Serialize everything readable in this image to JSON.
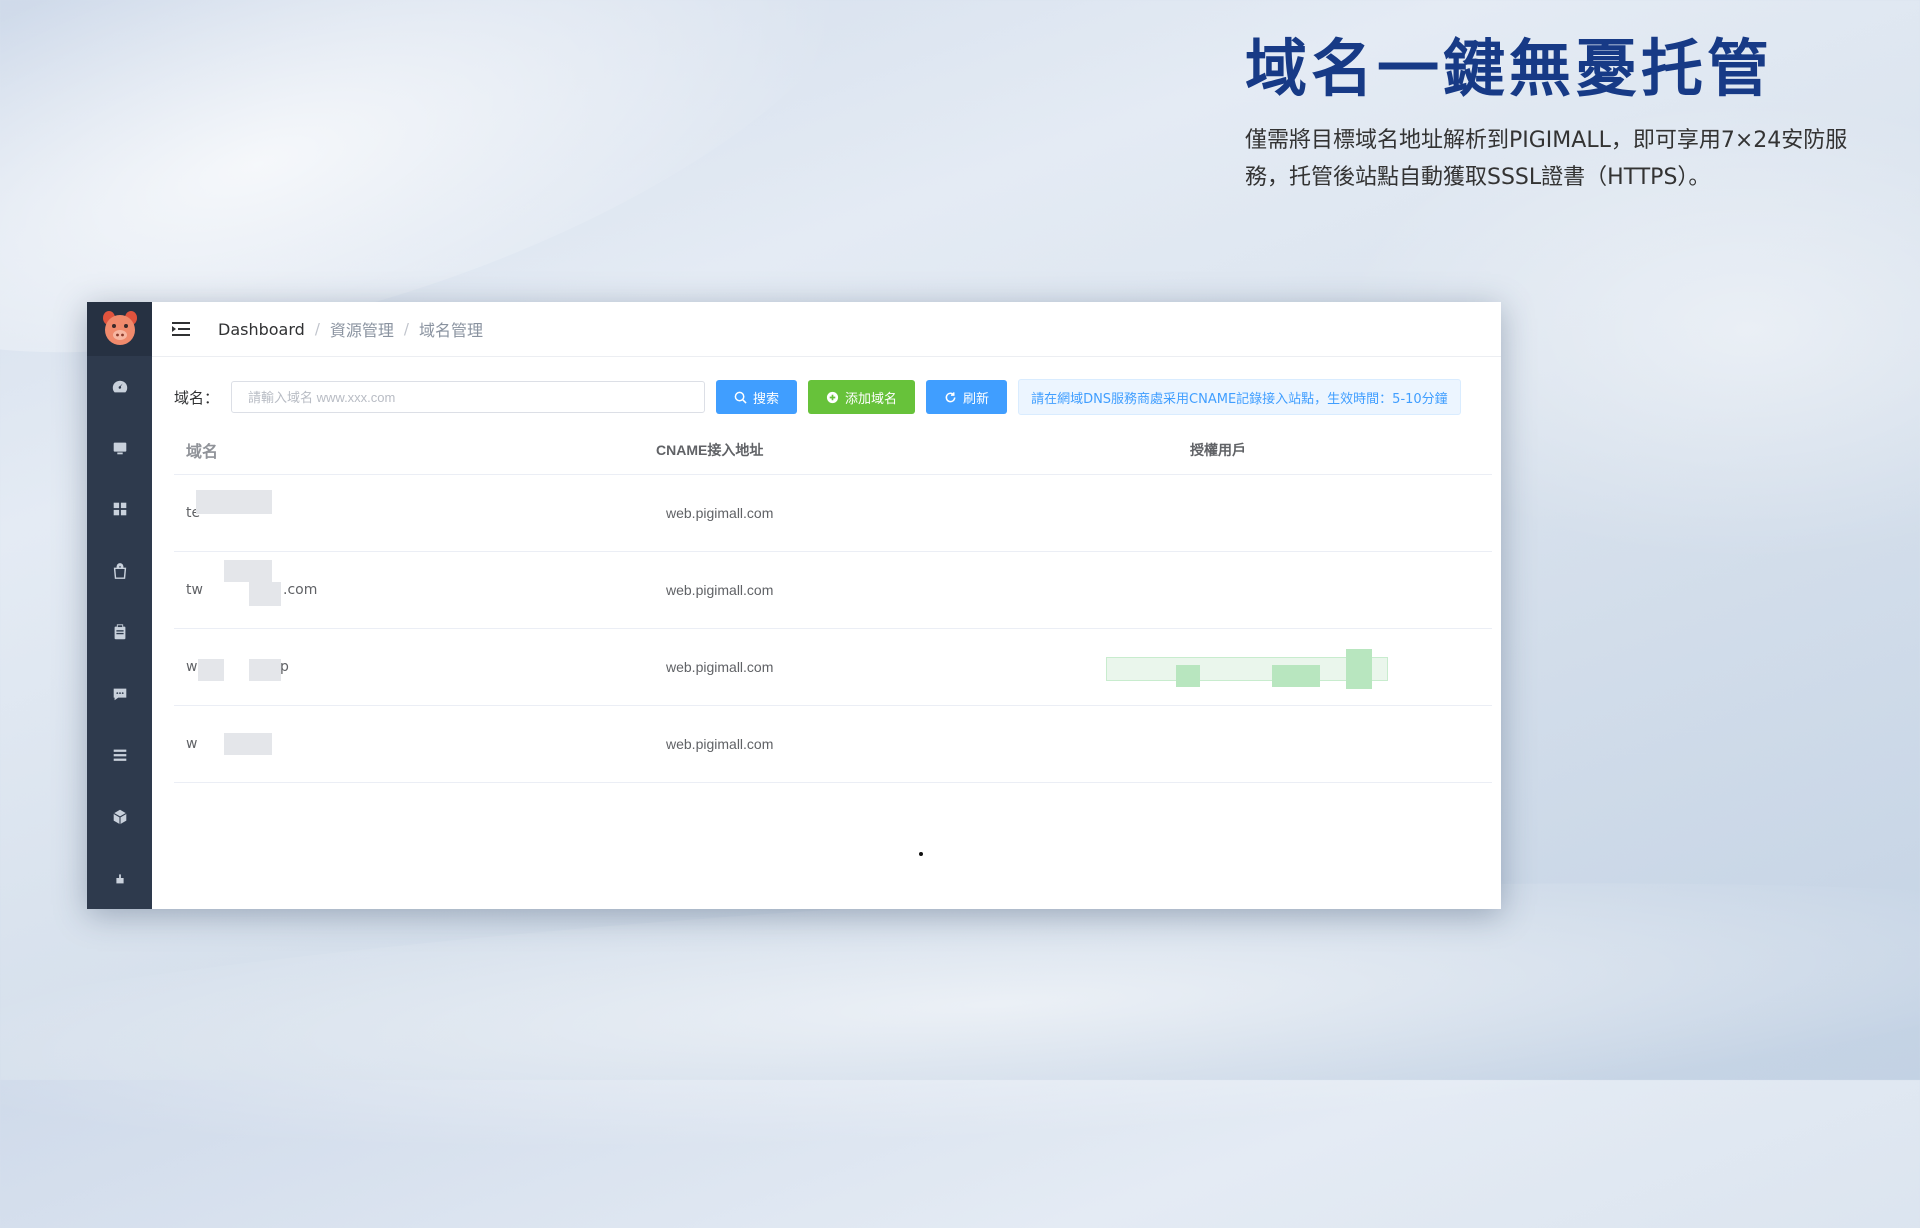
{
  "headline": "域名一鍵無憂托管",
  "subtext": "僅需將目標域名地址解析到PIGIMALL，即可享用7×24安防服務，托管後站點自動獲取SSSL證書（HTTPS）。",
  "breadcrumb": {
    "home": "Dashboard",
    "sep": "/",
    "level1": "資源管理",
    "level2": "域名管理"
  },
  "filter": {
    "label": "域名：",
    "placeholder": "請輸入域名 www.xxx.com",
    "search_label": "搜索",
    "add_label": "添加域名",
    "refresh_label": "刷新",
    "notice": "請在網域DNS服務商處采用CNAME記錄接入站點，生效時間：5-10分鐘"
  },
  "table": {
    "headers": [
      "域名",
      "CNAME接入地址",
      "授權用戶"
    ],
    "rows": [
      {
        "domain_prefix": "te",
        "domain_suffix": "",
        "cname": "web.pigimall.com"
      },
      {
        "domain_prefix": "tw",
        "domain_suffix": ".com",
        "cname": "web.pigimall.com"
      },
      {
        "domain_prefix": "w",
        "domain_suffix": "p",
        "cname": "web.pigimall.com"
      },
      {
        "domain_prefix": "w",
        "domain_suffix": "",
        "cname": "web.pigimall.com"
      }
    ]
  },
  "sidebar": {
    "icons": [
      "dashboard-icon",
      "monitor-icon",
      "grid-icon",
      "bag-icon",
      "clipboard-icon",
      "chat-icon",
      "list-icon",
      "cube-icon",
      "tool-icon"
    ]
  },
  "colors": {
    "headline": "#173a86",
    "sidebar": "#2e3a4d",
    "primary": "#409eff",
    "success": "#67c23a"
  }
}
